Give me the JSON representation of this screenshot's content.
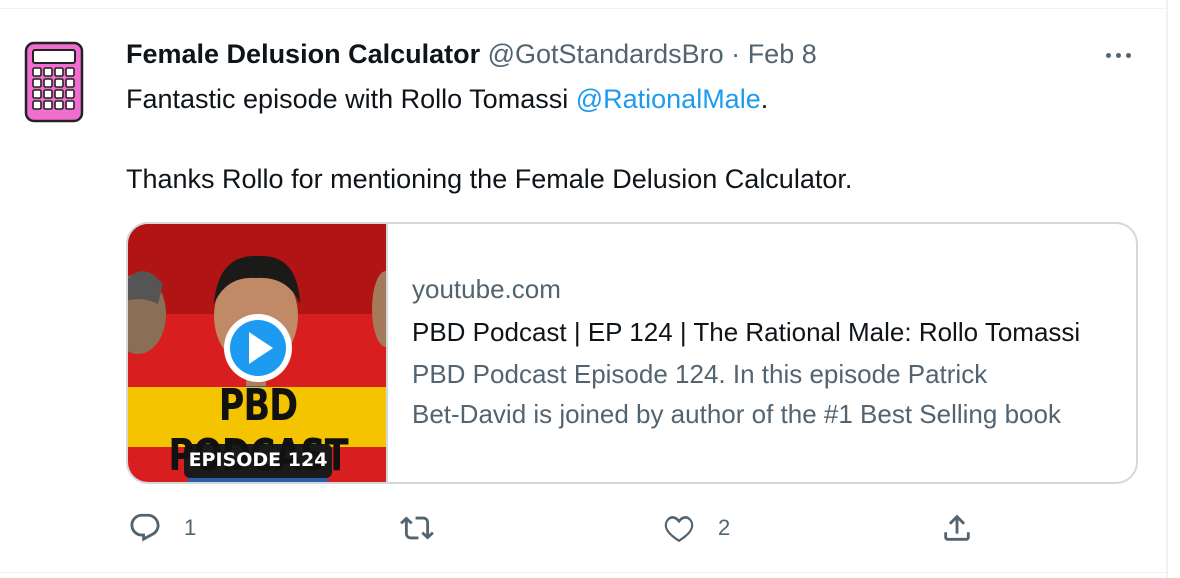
{
  "tweet": {
    "author_name": "Female Delusion Calculator",
    "author_handle": "@GotStandardsBro",
    "separator": "·",
    "date": "Feb 8",
    "line1_prefix": "Fantastic episode with Rollo Tomassi ",
    "line1_mention": "@RationalMale",
    "line1_suffix": ".",
    "line2": "Thanks Rollo for mentioning the Female Delusion Calculator."
  },
  "card": {
    "domain": "youtube.com",
    "title": "PBD Podcast | EP 124 | The Rational Male: Rollo Tomassi",
    "description_line1": "PBD Podcast Episode 124. In this episode Patrick",
    "description_line2": "Bet-David is joined by author of the #1 Best Selling book",
    "thumbnail": {
      "banner_text": "PBD PODCAST",
      "episode_text": "EPISODE 124",
      "play_icon": "play-icon"
    }
  },
  "actions": {
    "reply": {
      "icon": "reply-icon",
      "count": "1"
    },
    "retweet": {
      "icon": "retweet-icon",
      "count": ""
    },
    "like": {
      "icon": "heart-icon",
      "count": "2"
    },
    "share": {
      "icon": "share-icon",
      "count": ""
    }
  },
  "colors": {
    "accent": "#1d9bf0",
    "muted": "#536471",
    "text": "#0f1419",
    "border": "#cfd9de",
    "calculator_pink": "#f06ecf",
    "banner_yellow": "#f5c400",
    "thumb_red": "#d81e1e"
  }
}
